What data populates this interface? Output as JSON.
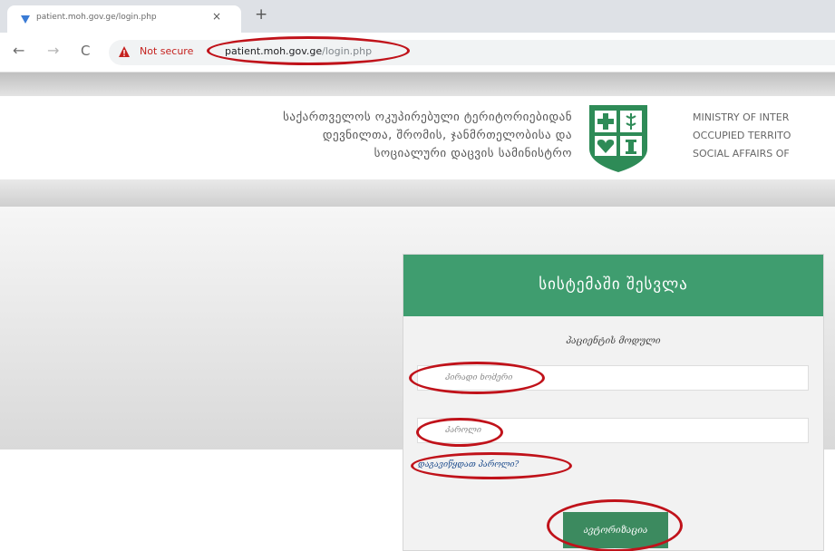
{
  "browser": {
    "tab_title": "patient.moh.gov.ge/login.php",
    "tab_close": "×",
    "new_tab": "+",
    "back": "←",
    "forward": "→",
    "reload": "C",
    "security_label": "Not secure",
    "url_host": "patient.moh.gov.ge",
    "url_path": "/login.php"
  },
  "site": {
    "geo_title_lines": [
      "საქართველოს ოკუპირებული ტერიტორიებიდან",
      "დევნილთა, შრომის, ჯანმრთელობისა და",
      "სოციალური დაცვის სამინისტრო"
    ],
    "eng_title_lines": [
      "MINISTRY OF INTER",
      "OCCUPIED TERRITO",
      "SOCIAL AFFAIRS OF"
    ],
    "emblem_color": "#2e8b57"
  },
  "login": {
    "title": "სისტემაში შესვლა",
    "subtitle": "პაციენტის მოდული",
    "personal_id_placeholder": "პირადი ნომერი",
    "password_placeholder": "პაროლი",
    "forgot_link": "დაგავიწყდათ პაროლი?",
    "submit_label": "ავტორიზაცია"
  },
  "colors": {
    "accent_green": "#3f9d6f",
    "button_green": "#3c8a5f",
    "annotation_red": "#c0121a",
    "warning_red": "#c5221f"
  }
}
